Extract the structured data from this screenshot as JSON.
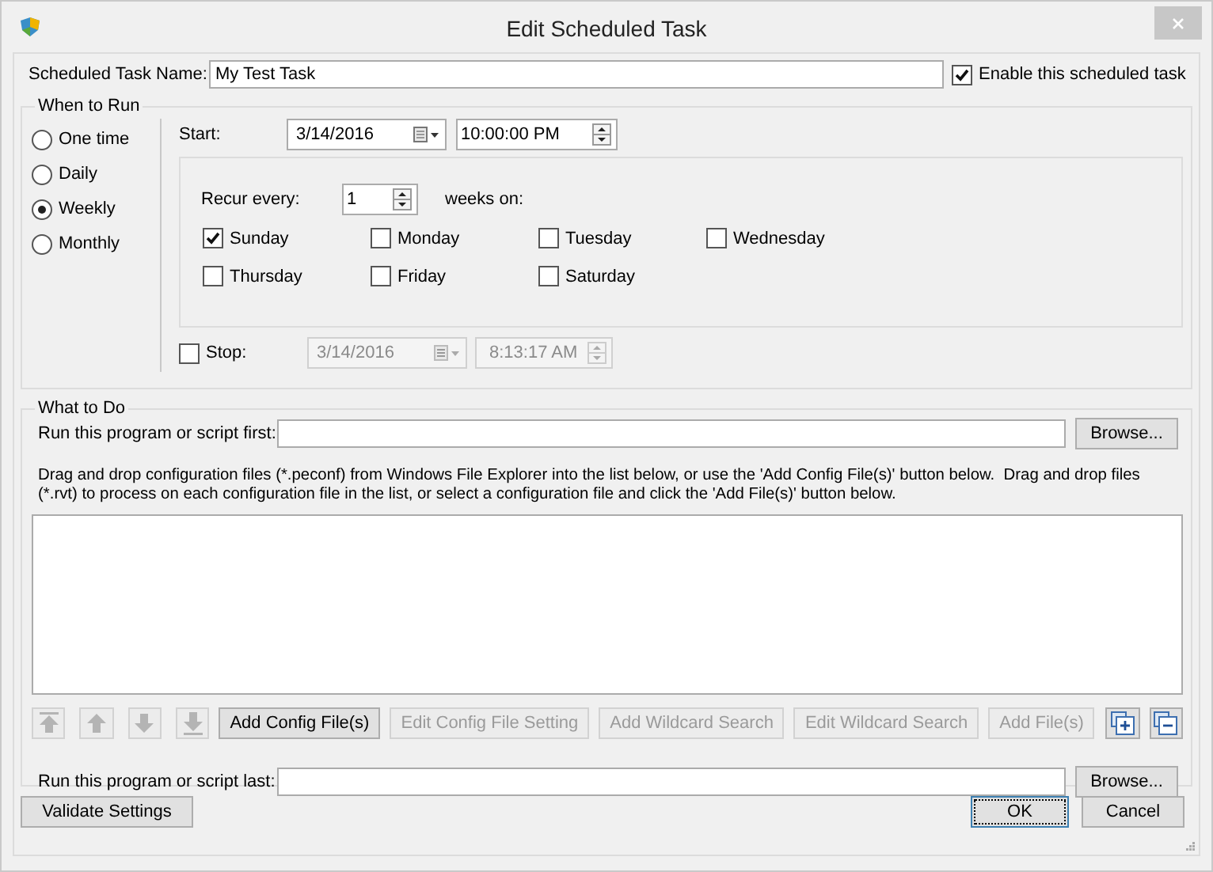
{
  "window": {
    "title": "Edit Scheduled Task"
  },
  "task_name": {
    "label": "Scheduled Task Name:",
    "value": "My Test Task"
  },
  "enable": {
    "label": "Enable this scheduled task",
    "checked": true
  },
  "when_to_run": {
    "title": "When to Run",
    "frequencies": [
      {
        "label": "One time",
        "selected": false
      },
      {
        "label": "Daily",
        "selected": false
      },
      {
        "label": "Weekly",
        "selected": true
      },
      {
        "label": "Monthly",
        "selected": false
      }
    ],
    "start": {
      "label": "Start:",
      "date": "3/14/2016",
      "time": "10:00:00 PM"
    },
    "recur": {
      "label": "Recur every:",
      "value": "1",
      "suffix": "weeks on:"
    },
    "days": [
      {
        "label": "Sunday",
        "checked": true
      },
      {
        "label": "Monday",
        "checked": false
      },
      {
        "label": "Tuesday",
        "checked": false
      },
      {
        "label": "Wednesday",
        "checked": false
      },
      {
        "label": "Thursday",
        "checked": false
      },
      {
        "label": "Friday",
        "checked": false
      },
      {
        "label": "Saturday",
        "checked": false
      }
    ],
    "stop": {
      "label": "Stop:",
      "checked": false,
      "disabled": true,
      "date": "3/14/2016",
      "time": "8:13:17 AM"
    }
  },
  "what_to_do": {
    "title": "What to Do",
    "run_first": {
      "label": "Run this program or script first:",
      "button": "Browse..."
    },
    "description": "Drag and drop configuration files (*.peconf) from Windows File Explorer into the list below, or use the 'Add Config File(s)' button below.  Drag and drop files (*.rvt) to process on each configuration file in the list, or select a configuration file and click the 'Add File(s)' button below.",
    "list_buttons": [
      {
        "kind": "move-top",
        "disabled": true
      },
      {
        "kind": "move-up",
        "disabled": true
      },
      {
        "kind": "move-down",
        "disabled": true
      },
      {
        "kind": "move-bottom",
        "disabled": true
      },
      {
        "kind": "text",
        "label": "Add Config File(s)",
        "disabled": false
      },
      {
        "kind": "text",
        "label": "Edit  Config  File Setting",
        "disabled": true
      },
      {
        "kind": "text",
        "label": "Add Wildcard Search",
        "disabled": true
      },
      {
        "kind": "text",
        "label": "Edit Wildcard Search",
        "disabled": true
      },
      {
        "kind": "text",
        "label": "Add File(s)",
        "disabled": true
      },
      {
        "kind": "expand",
        "disabled": false
      },
      {
        "kind": "collapse",
        "disabled": false
      }
    ],
    "run_last": {
      "label": "Run this program or script last:",
      "button": "Browse..."
    }
  },
  "footer_buttons": [
    {
      "label": "Validate Settings",
      "focused": false
    },
    {
      "label": "OK",
      "focused": true
    },
    {
      "label": "Cancel",
      "focused": false
    }
  ]
}
